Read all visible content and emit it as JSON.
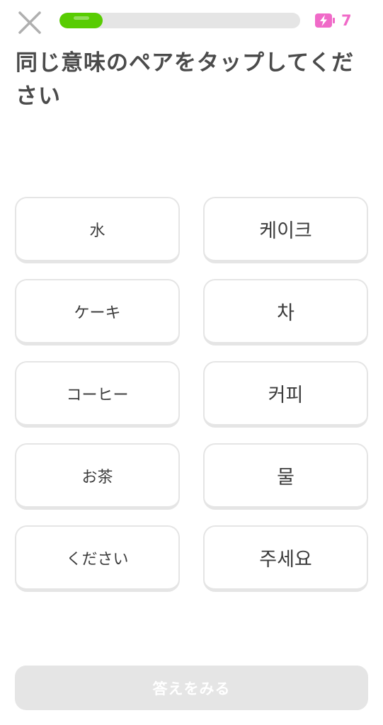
{
  "header": {
    "close_icon": "close-icon",
    "progress": 0.18,
    "progress_color": "#58cc02",
    "energy_icon": "battery-bolt-icon",
    "energy_count": "7",
    "energy_color": "#f06ac8"
  },
  "prompt": {
    "title": "同じ意味のペアをタップしてください"
  },
  "pairs": {
    "left": [
      "水",
      "ケーキ",
      "コーヒー",
      "お茶",
      "ください"
    ],
    "right": [
      "케이크",
      "차",
      "커피",
      "물",
      "주세요"
    ]
  },
  "footer": {
    "check_label": "答えをみる",
    "check_enabled": false
  }
}
